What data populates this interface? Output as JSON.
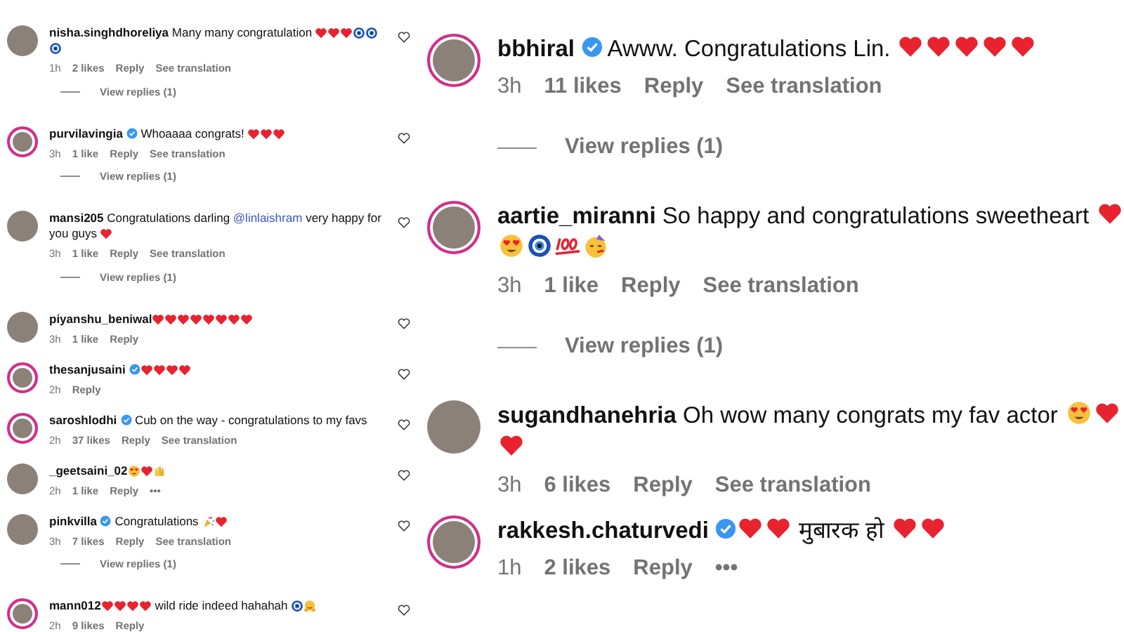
{
  "panels": [
    {
      "items": [
        {
          "kind": "comment",
          "username": "nisha.singhdhoreliya",
          "verified": false,
          "ring": false,
          "liked": false,
          "body": [
            {
              "kind": "text",
              "text": "Many many congratulation"
            },
            {
              "kind": "heart"
            },
            {
              "kind": "heart"
            },
            {
              "kind": "heart"
            },
            {
              "kind": "nazar"
            },
            {
              "kind": "nazar"
            },
            {
              "kind": "nazar"
            }
          ],
          "meta": {
            "time": "1h",
            "likes": "2 likes",
            "reply": "Reply",
            "translation": "See translation"
          }
        },
        {
          "kind": "replies",
          "text": "View replies (1)"
        },
        {
          "kind": "comment",
          "username": "purvilavingia",
          "verified": true,
          "ring": true,
          "liked": false,
          "body": [
            {
              "kind": "text",
              "text": "Whoaaaa congrats!"
            },
            {
              "kind": "heart"
            },
            {
              "kind": "heart"
            },
            {
              "kind": "heart"
            }
          ],
          "meta": {
            "time": "3h",
            "likes": "1 like",
            "reply": "Reply",
            "translation": "See translation"
          }
        },
        {
          "kind": "replies",
          "text": "View replies (1)"
        },
        {
          "kind": "comment",
          "username": "mansi205",
          "verified": false,
          "ring": false,
          "liked": false,
          "body": [
            {
              "kind": "text",
              "text": "Congratulations darling"
            },
            {
              "kind": "mention",
              "text": "@linlaishram"
            },
            {
              "kind": "text",
              "text": "very happy for you guys"
            },
            {
              "kind": "heart"
            }
          ],
          "meta": {
            "time": "3h",
            "likes": "1 like",
            "reply": "Reply",
            "translation": "See translation"
          }
        },
        {
          "kind": "replies",
          "text": "View replies (1)"
        },
        {
          "kind": "comment",
          "username": "piyanshu_beniwal",
          "verified": false,
          "ring": false,
          "liked": false,
          "body": [
            {
              "kind": "heart"
            },
            {
              "kind": "heart"
            },
            {
              "kind": "heart"
            },
            {
              "kind": "heart"
            },
            {
              "kind": "heart"
            },
            {
              "kind": "heart"
            },
            {
              "kind": "heart"
            },
            {
              "kind": "heart"
            }
          ],
          "meta": {
            "time": "3h",
            "likes": "1 like",
            "reply": "Reply"
          }
        },
        {
          "kind": "comment",
          "username": "thesanjusaini",
          "verified": true,
          "ring": true,
          "liked": false,
          "body": [
            {
              "kind": "heart"
            },
            {
              "kind": "heart"
            },
            {
              "kind": "heart"
            },
            {
              "kind": "heart"
            }
          ],
          "meta": {
            "time": "2h",
            "reply": "Reply"
          }
        },
        {
          "kind": "comment",
          "username": "saroshlodhi",
          "verified": true,
          "ring": true,
          "liked": false,
          "body": [
            {
              "kind": "text",
              "text": "Cub on the way - congratulations to my favs"
            }
          ],
          "meta": {
            "time": "2h",
            "likes": "37 likes",
            "reply": "Reply",
            "translation": "See translation"
          }
        },
        {
          "kind": "comment",
          "username": "_geetsaini_02",
          "verified": false,
          "ring": false,
          "liked": false,
          "body": [
            {
              "kind": "heart-eyes"
            },
            {
              "kind": "heart"
            },
            {
              "kind": "raised-hands"
            }
          ],
          "meta": {
            "time": "2h",
            "likes": "1 like",
            "reply": "Reply",
            "more": "•••"
          }
        },
        {
          "kind": "comment",
          "username": "pinkvilla",
          "verified": true,
          "ring": false,
          "liked": false,
          "body": [
            {
              "kind": "text",
              "text": "Congratulations"
            },
            {
              "kind": "party-popper"
            },
            {
              "kind": "heart"
            }
          ],
          "meta": {
            "time": "3h",
            "likes": "7 likes",
            "reply": "Reply",
            "translation": "See translation"
          }
        },
        {
          "kind": "replies",
          "text": "View replies (1)"
        },
        {
          "kind": "comment",
          "username": "mann012",
          "verified": false,
          "ring": true,
          "liked": false,
          "body": [
            {
              "kind": "heart"
            },
            {
              "kind": "heart"
            },
            {
              "kind": "heart"
            },
            {
              "kind": "heart"
            },
            {
              "kind": "text",
              "text": "wild ride indeed hahahah"
            },
            {
              "kind": "nazar"
            },
            {
              "kind": "hug"
            }
          ],
          "meta": {
            "time": "2h",
            "likes": "9 likes",
            "reply": "Reply"
          }
        }
      ]
    },
    {
      "items": [
        {
          "kind": "comment",
          "username": "bbhiral",
          "verified": true,
          "ring": true,
          "body": [
            {
              "kind": "text",
              "text": "Awww. Congratulations Lin."
            },
            {
              "kind": "heart"
            },
            {
              "kind": "heart"
            },
            {
              "kind": "heart"
            },
            {
              "kind": "heart"
            },
            {
              "kind": "heart"
            }
          ],
          "meta": {
            "time": "3h",
            "likes": "11 likes",
            "reply": "Reply",
            "translation": "See translation"
          }
        },
        {
          "kind": "replies",
          "text": "View replies (1)"
        },
        {
          "kind": "comment",
          "username": "aartie_miranni",
          "verified": false,
          "ring": true,
          "body": [
            {
              "kind": "text",
              "text": "So happy and congratulations sweetheart"
            },
            {
              "kind": "heart"
            },
            {
              "kind": "heart-eyes"
            },
            {
              "kind": "nazar"
            },
            {
              "kind": "hundred"
            },
            {
              "kind": "party-face"
            }
          ],
          "meta": {
            "time": "3h",
            "likes": "1 like",
            "reply": "Reply",
            "translation": "See translation"
          }
        },
        {
          "kind": "replies",
          "text": "View replies (1)"
        },
        {
          "kind": "comment",
          "username": "sugandhanehria",
          "verified": false,
          "ring": false,
          "body": [
            {
              "kind": "text",
              "text": "Oh wow many congrats my fav actor"
            },
            {
              "kind": "heart-eyes"
            },
            {
              "kind": "heart"
            },
            {
              "kind": "heart"
            }
          ],
          "meta": {
            "time": "3h",
            "likes": "6 likes",
            "reply": "Reply",
            "translation": "See translation"
          }
        },
        {
          "kind": "comment",
          "username": "rakkesh.chaturvedi",
          "verified": true,
          "ring": true,
          "body": [
            {
              "kind": "heart"
            },
            {
              "kind": "heart"
            },
            {
              "kind": "text",
              "text": "मुबारक हो"
            },
            {
              "kind": "heart"
            },
            {
              "kind": "heart"
            }
          ],
          "meta": {
            "time": "1h",
            "likes": "2 likes",
            "reply": "Reply",
            "more": "•••"
          }
        }
      ]
    }
  ]
}
